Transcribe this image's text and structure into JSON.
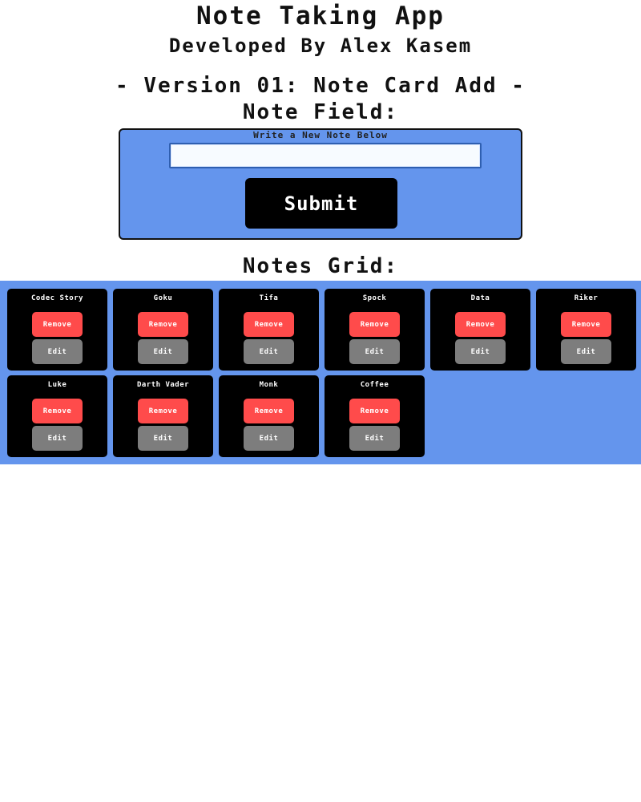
{
  "header": {
    "title": "Note Taking App",
    "subtitle": "Developed By Alex Kasem",
    "version": "- Version 01: Note Card Add -",
    "note_field_heading": "Note Field:"
  },
  "form": {
    "label": "Write a New Note Below",
    "input_value": "",
    "input_placeholder": "",
    "submit_label": "Submit"
  },
  "grid": {
    "heading": "Notes Grid:",
    "remove_label": "Remove",
    "edit_label": "Edit",
    "notes": [
      "Codec Story",
      "Goku",
      "Tifa",
      "Spock",
      "Data",
      "Riker",
      "Luke",
      "Darth Vader",
      "Monk",
      "Coffee"
    ]
  },
  "colors": {
    "panel_background": "#6495ed",
    "card_background": "#000000",
    "remove_button": "#ff4b4b",
    "edit_button": "#7d7d7d"
  }
}
